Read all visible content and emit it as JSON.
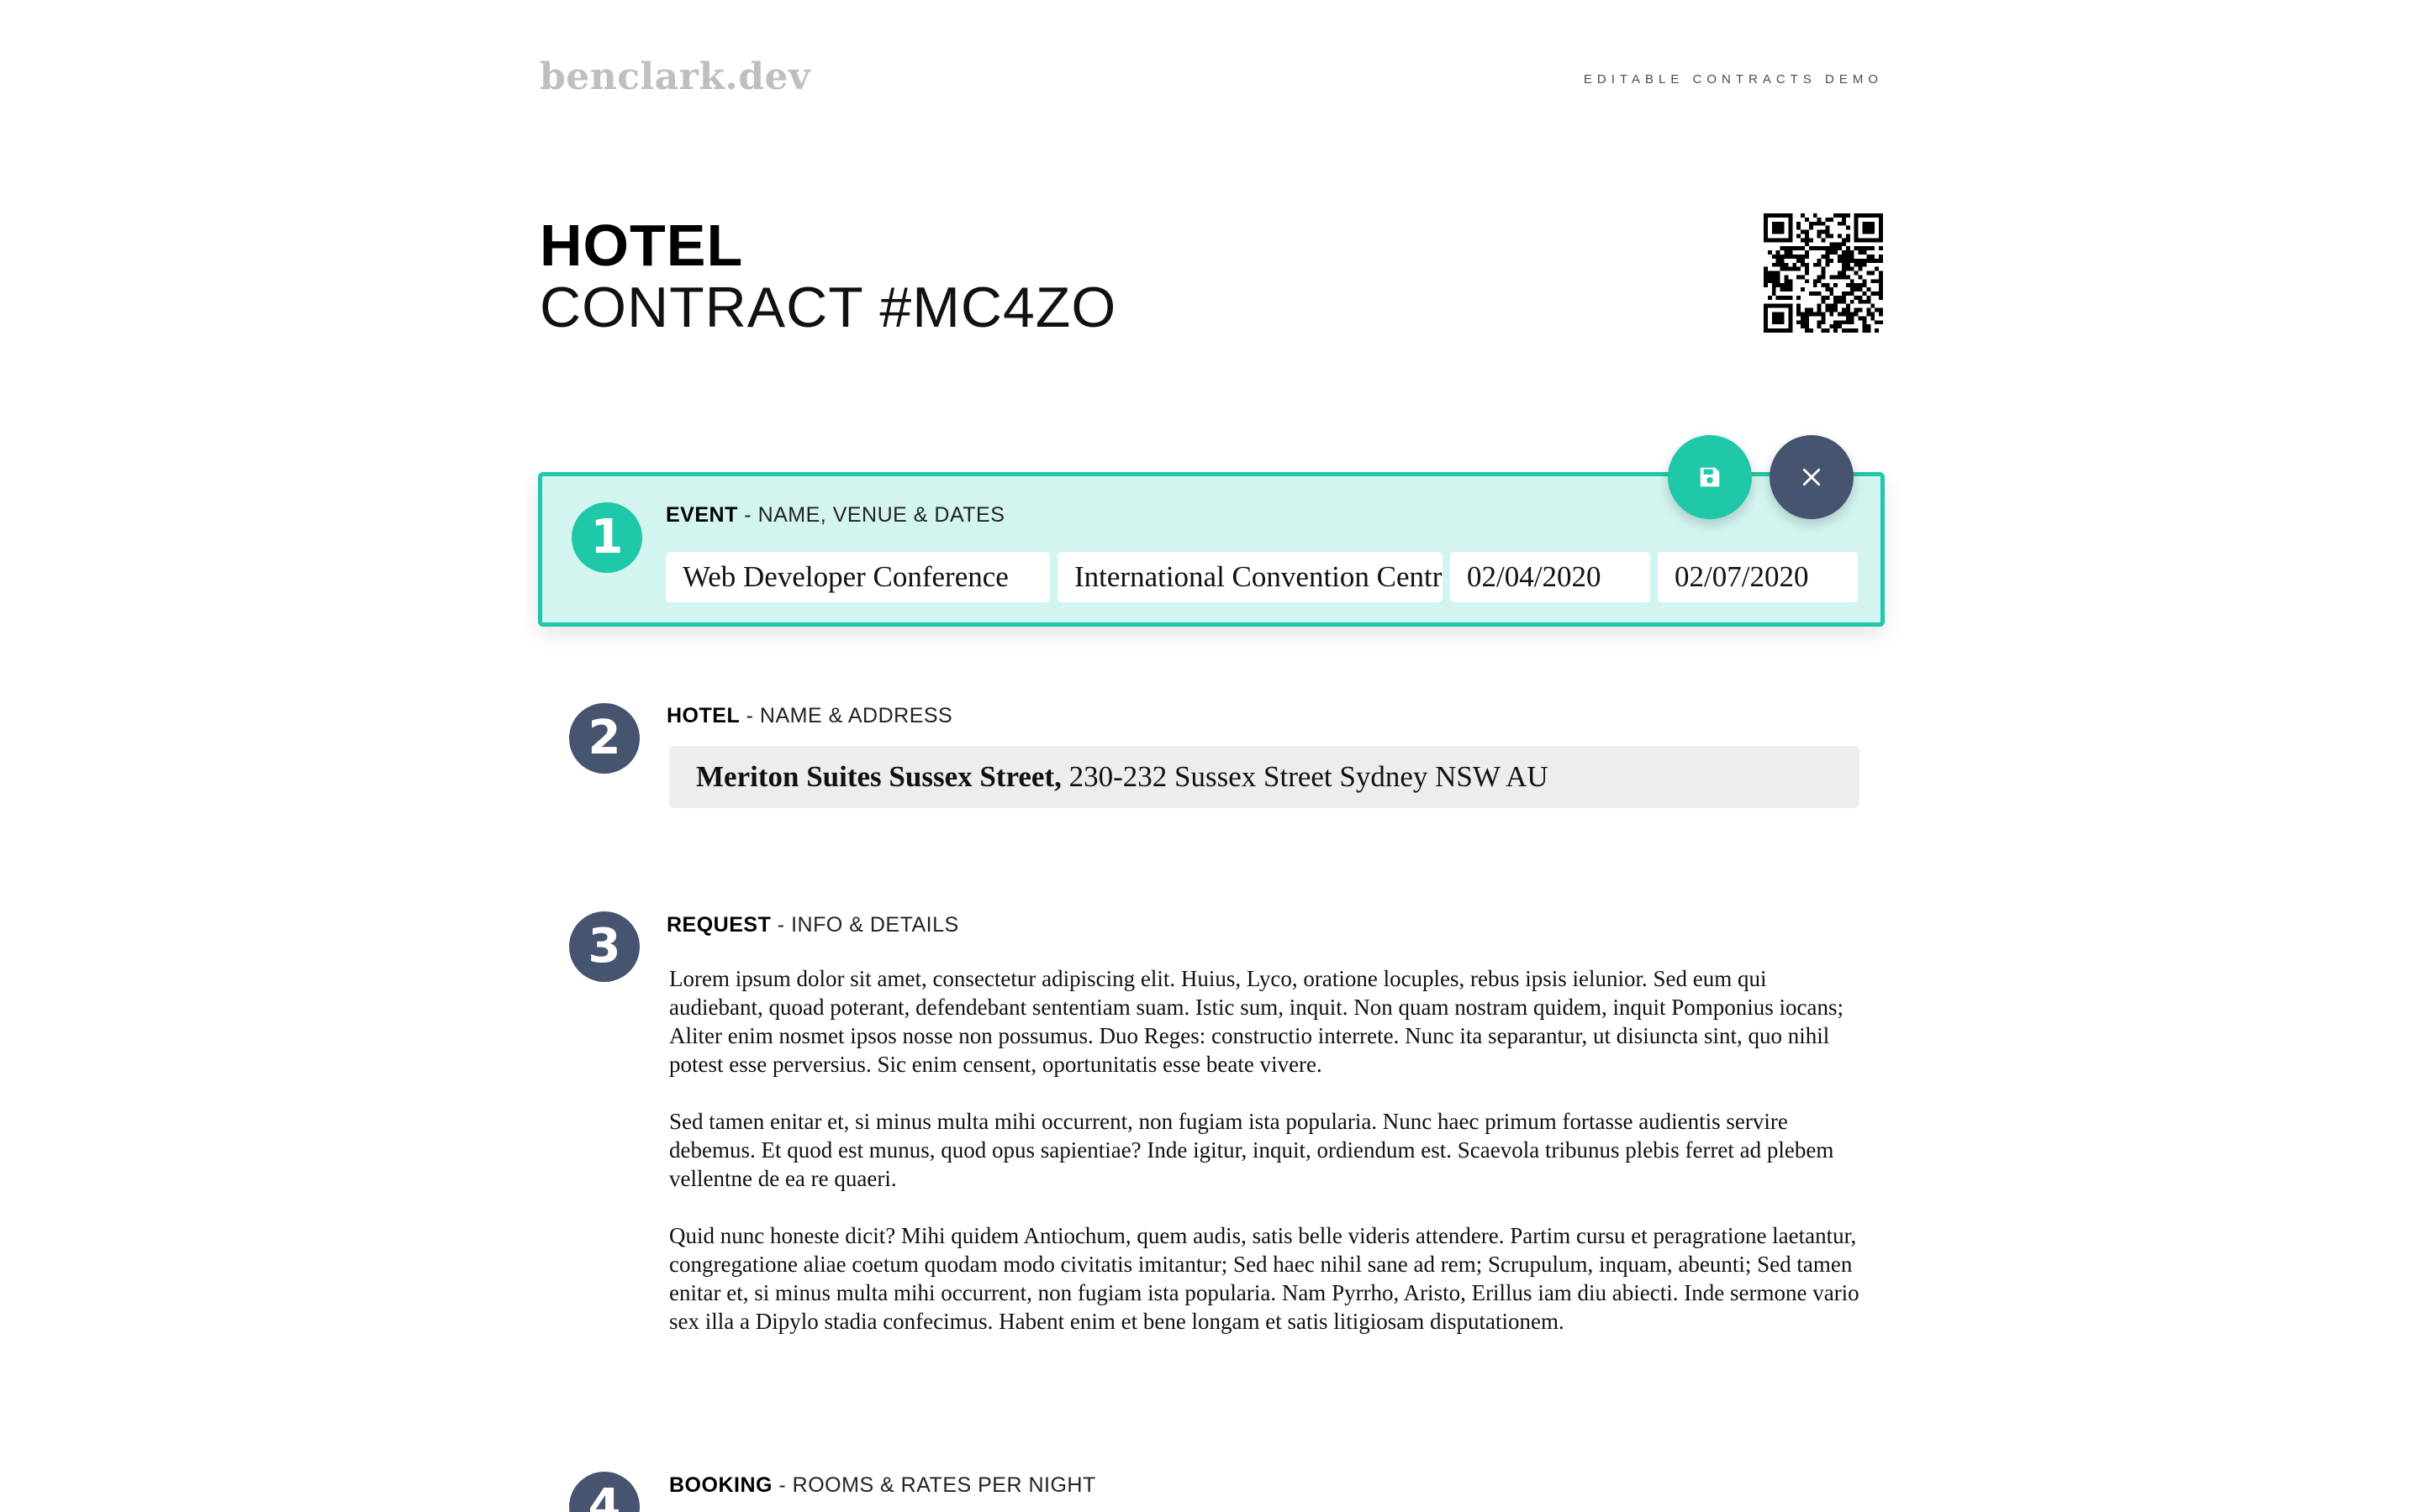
{
  "header": {
    "brand": "benclark.dev",
    "demo_label": "EDITABLE CONTRACTS DEMO"
  },
  "title": {
    "main": "HOTEL",
    "sub": "CONTRACT #MC4ZO"
  },
  "sections": {
    "event": {
      "number": "1",
      "label_bold": "EVENT",
      "label_rest": " - NAME, VENUE & DATES",
      "fields": {
        "name": "Web Developer Conference",
        "venue": "International Convention Centre",
        "start_date": "02/04/2020",
        "end_date": "02/07/2020"
      }
    },
    "hotel": {
      "number": "2",
      "label_bold": "HOTEL",
      "label_rest": " - NAME & ADDRESS",
      "name": "Meriton Suites Sussex Street,",
      "address": " 230-232 Sussex Street Sydney NSW AU"
    },
    "request": {
      "number": "3",
      "label_bold": "REQUEST",
      "label_rest": " - INFO & DETAILS",
      "paragraphs": [
        "Lorem ipsum dolor sit amet, consectetur adipiscing elit. Huius, Lyco, oratione locuples, rebus ipsis ielunior. Sed eum qui audiebant, quoad poterant, defendebant sententiam suam. Istic sum, inquit. Non quam nostram quidem, inquit Pomponius iocans; Aliter enim nosmet ipsos nosse non possumus. Duo Reges: constructio interrete. Nunc ita separantur, ut disiuncta sint, quo nihil potest esse perversius. Sic enim censent, oportunitatis esse beate vivere.",
        "Sed tamen enitar et, si minus multa mihi occurrent, non fugiam ista popularia. Nunc haec primum fortasse audientis servire debemus. Et quod est munus, quod opus sapientiae? Inde igitur, inquit, ordiendum est. Scaevola tribunus plebis ferret ad plebem vellentne de ea re quaeri.",
        "Quid nunc honeste dicit? Mihi quidem Antiochum, quem audis, satis belle videris attendere. Partim cursu et peragratione laetantur, congregatione aliae coetum quodam modo civitatis imitantur; Sed haec nihil sane ad rem; Scrupulum, inquam, abeunti; Sed tamen enitar et, si minus multa mihi occurrent, non fugiam ista popularia. Nam Pyrrho, Aristo, Erillus iam diu abiecti. Inde sermone vario sex illa a Dipylo stadia confecimus. Habent enim et bene longam et satis litigiosam disputationem."
      ]
    },
    "booking": {
      "number": "4",
      "label_bold": "BOOKING",
      "label_rest": " - ROOMS & RATES PER NIGHT"
    }
  },
  "actions": {
    "save_icon": "save-icon",
    "close_icon": "close-icon"
  },
  "colors": {
    "accent": "#1fc8a8",
    "accent_light": "#d2f5ef",
    "slate": "#475470",
    "field_gray": "#ecedf0",
    "brand_gray": "#bdbfc1"
  }
}
